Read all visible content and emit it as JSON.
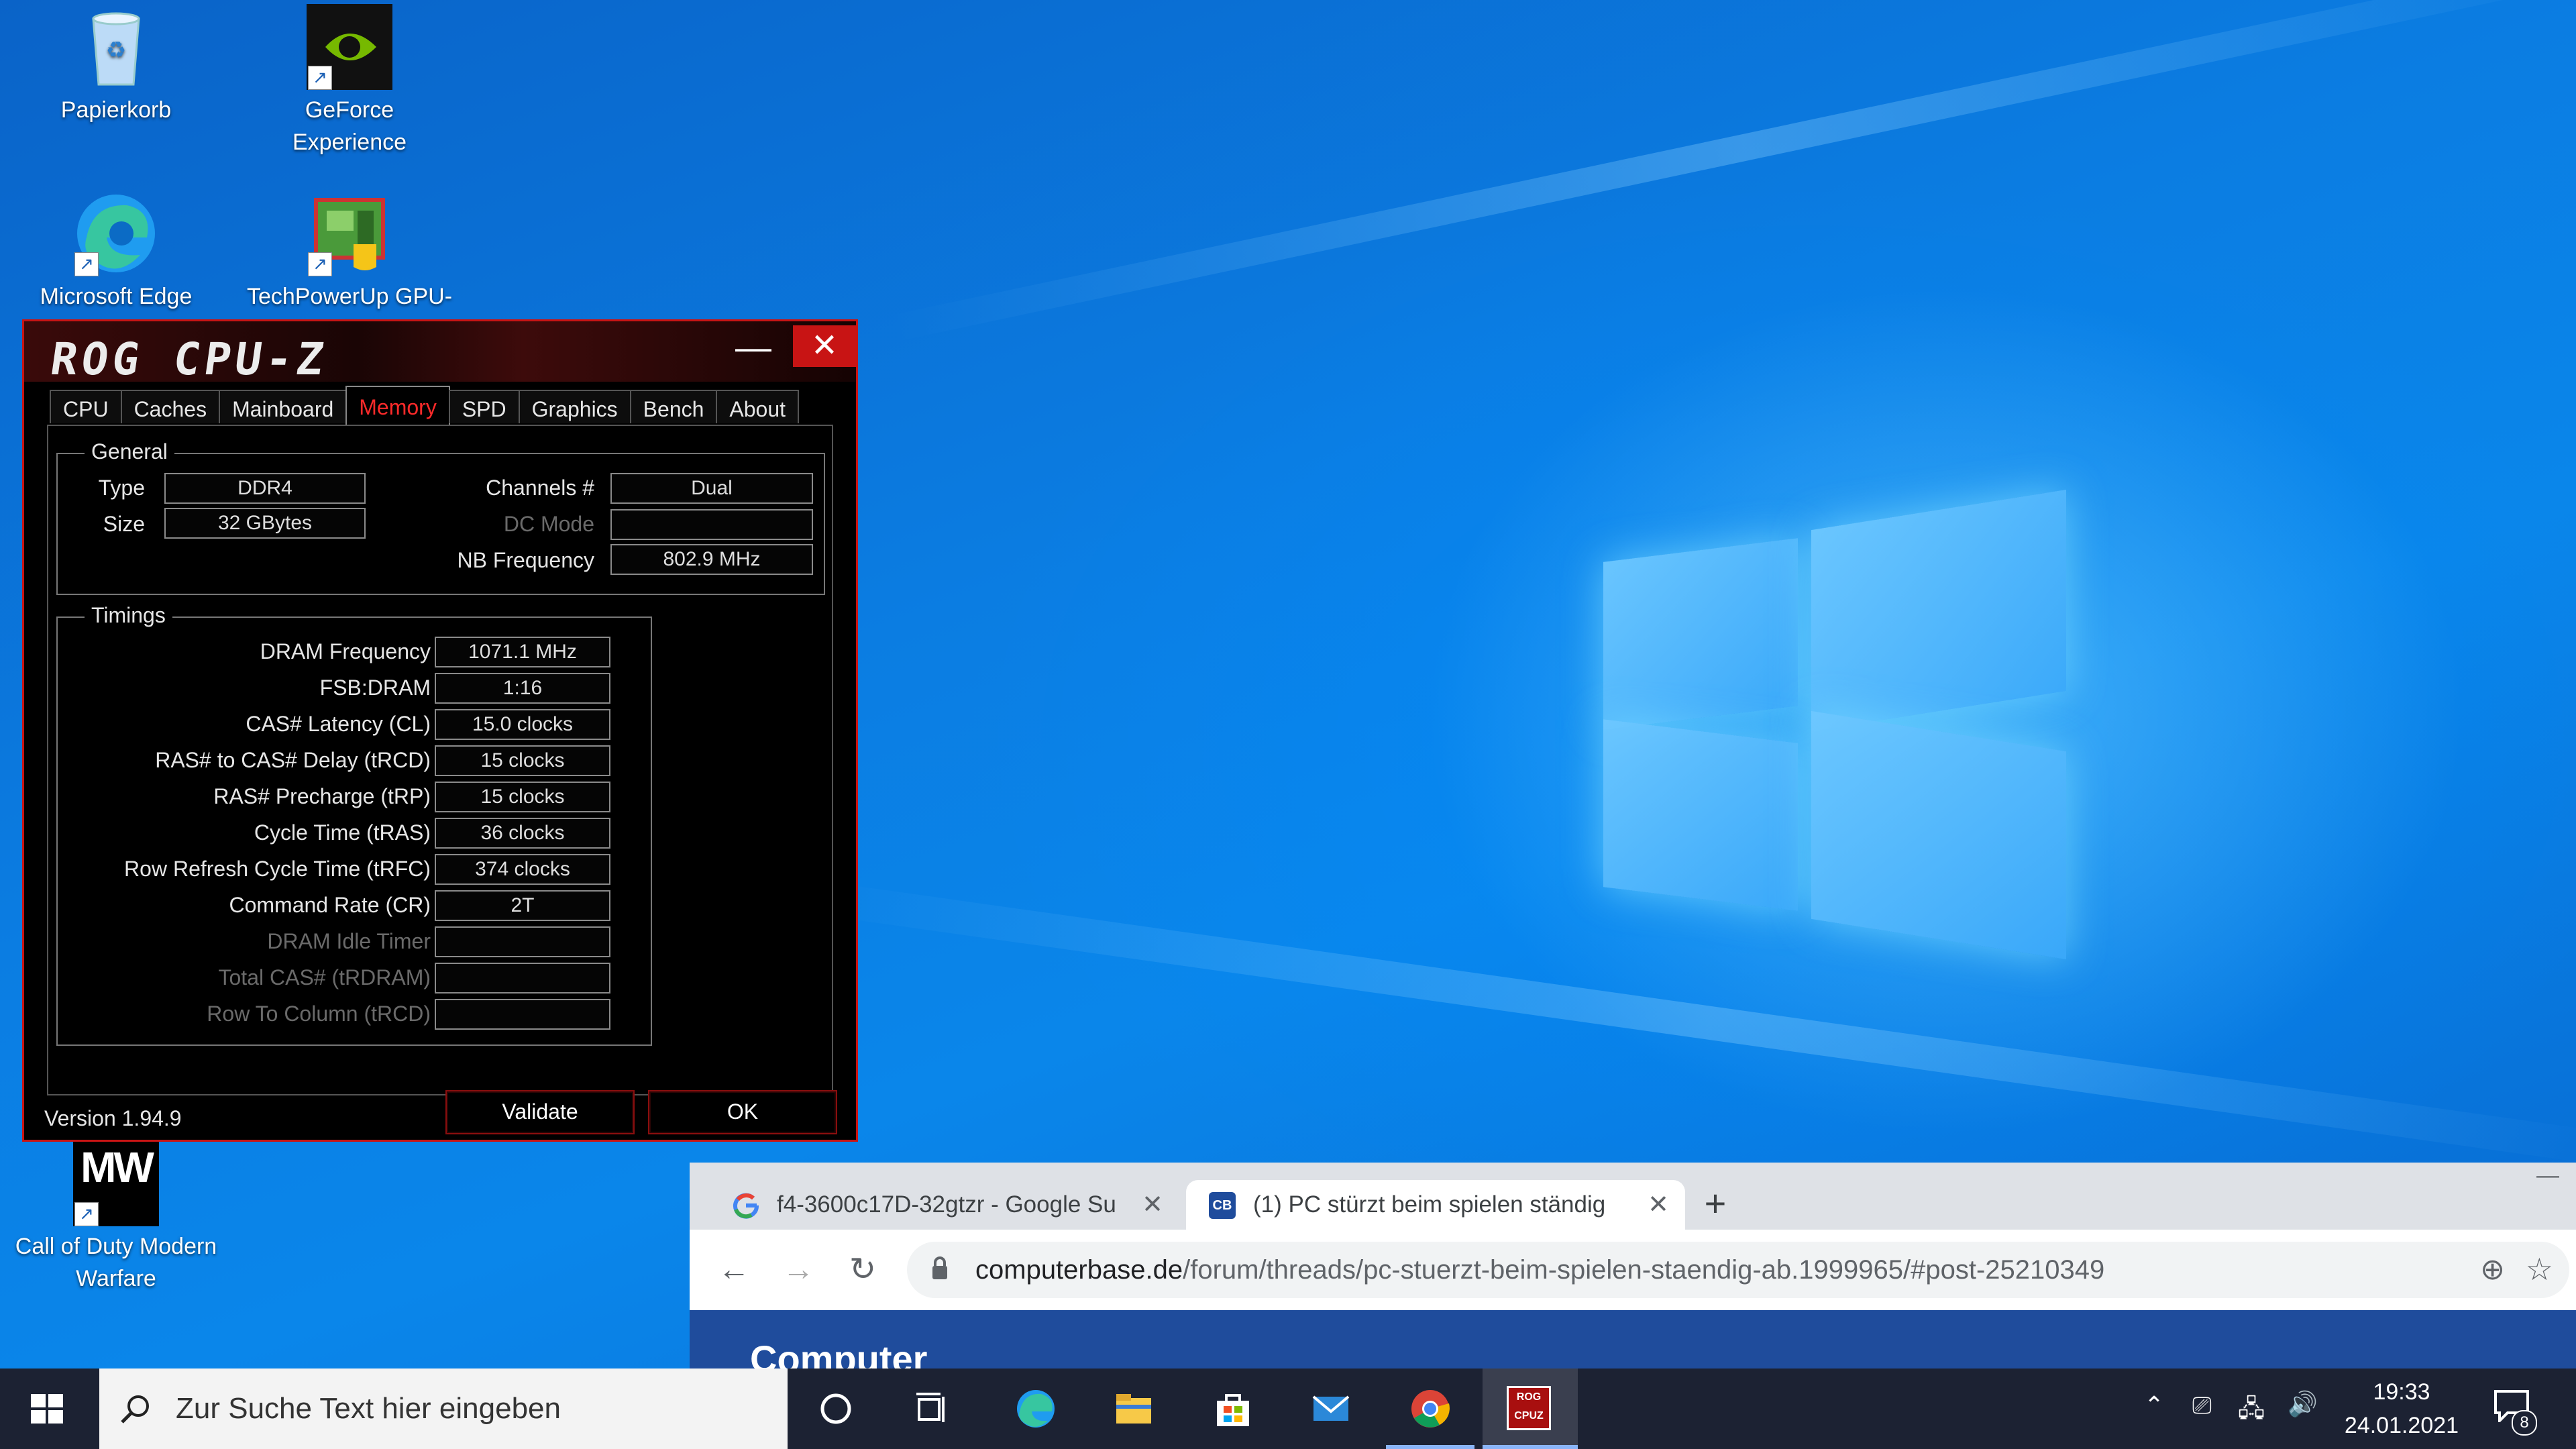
{
  "desktop": {
    "icons": [
      {
        "label": "Papierkorb",
        "icon": "recycle-bin-icon"
      },
      {
        "label": "GeForce Experience",
        "icon": "nvidia-geforce-icon"
      },
      {
        "label": "Microsoft Edge",
        "icon": "edge-icon"
      },
      {
        "label": "TechPowerUp GPU-Z",
        "icon": "gpu-z-icon"
      },
      {
        "label": "Call of Duty Modern Warfare",
        "icon": "mw-icon",
        "logo_text": "MW"
      }
    ]
  },
  "cpuz": {
    "title": "ROG CPU-Z",
    "minimize": "—",
    "close": "✕",
    "tabs": [
      "CPU",
      "Caches",
      "Mainboard",
      "Memory",
      "SPD",
      "Graphics",
      "Bench",
      "About"
    ],
    "active_tab": "Memory",
    "general": {
      "title": "General",
      "type_label": "Type",
      "type_value": "DDR4",
      "size_label": "Size",
      "size_value": "32 GBytes",
      "channels_label": "Channels #",
      "channels_value": "Dual",
      "dc_mode_label": "DC Mode",
      "dc_mode_value": "",
      "nb_freq_label": "NB Frequency",
      "nb_freq_value": "802.9 MHz"
    },
    "timings": {
      "title": "Timings",
      "rows": [
        {
          "label": "DRAM Frequency",
          "value": "1071.1 MHz",
          "enabled": true
        },
        {
          "label": "FSB:DRAM",
          "value": "1:16",
          "enabled": true
        },
        {
          "label": "CAS# Latency (CL)",
          "value": "15.0 clocks",
          "enabled": true
        },
        {
          "label": "RAS# to CAS# Delay (tRCD)",
          "value": "15 clocks",
          "enabled": true
        },
        {
          "label": "RAS# Precharge (tRP)",
          "value": "15 clocks",
          "enabled": true
        },
        {
          "label": "Cycle Time (tRAS)",
          "value": "36 clocks",
          "enabled": true
        },
        {
          "label": "Row Refresh Cycle Time (tRFC)",
          "value": "374 clocks",
          "enabled": true
        },
        {
          "label": "Command Rate (CR)",
          "value": "2T",
          "enabled": true
        },
        {
          "label": "DRAM Idle Timer",
          "value": "",
          "enabled": false
        },
        {
          "label": "Total CAS# (tRDRAM)",
          "value": "",
          "enabled": false
        },
        {
          "label": "Row To Column (tRCD)",
          "value": "",
          "enabled": false
        }
      ]
    },
    "version": "Version 1.94.9",
    "validate_label": "Validate",
    "ok_label": "OK"
  },
  "chrome": {
    "tabs": [
      {
        "title": "f4-3600c17D-32gtzr - Google Su",
        "favicon": "google-g-icon",
        "active": false
      },
      {
        "title": "(1) PC stürzt beim spielen ständig",
        "favicon": "computerbase-icon",
        "favicon_text": "CB",
        "active": true
      }
    ],
    "new_tab": "+",
    "minimize": "—",
    "url_domain": "computerbase.de",
    "url_path": "/forum/threads/pc-stuerzt-beim-spielen-staendig-ab.1999965/#post-25210349",
    "page_logo_text": "Computer"
  },
  "taskbar": {
    "search_placeholder": "Zur Suche Text hier eingeben",
    "apps": [
      "cortana-icon",
      "task-view-icon",
      "edge-icon",
      "file-explorer-icon",
      "store-icon",
      "mail-icon",
      "chrome-icon",
      "cpuz-icon"
    ],
    "cpuz_icon_text": "ROG CPUZ",
    "time": "19:33",
    "date": "24.01.2021",
    "notification_count": "8"
  },
  "colors": {
    "cpuz_accent": "#c81414",
    "desktop_blue": "#0a79df",
    "taskbar": "#1c2233"
  }
}
